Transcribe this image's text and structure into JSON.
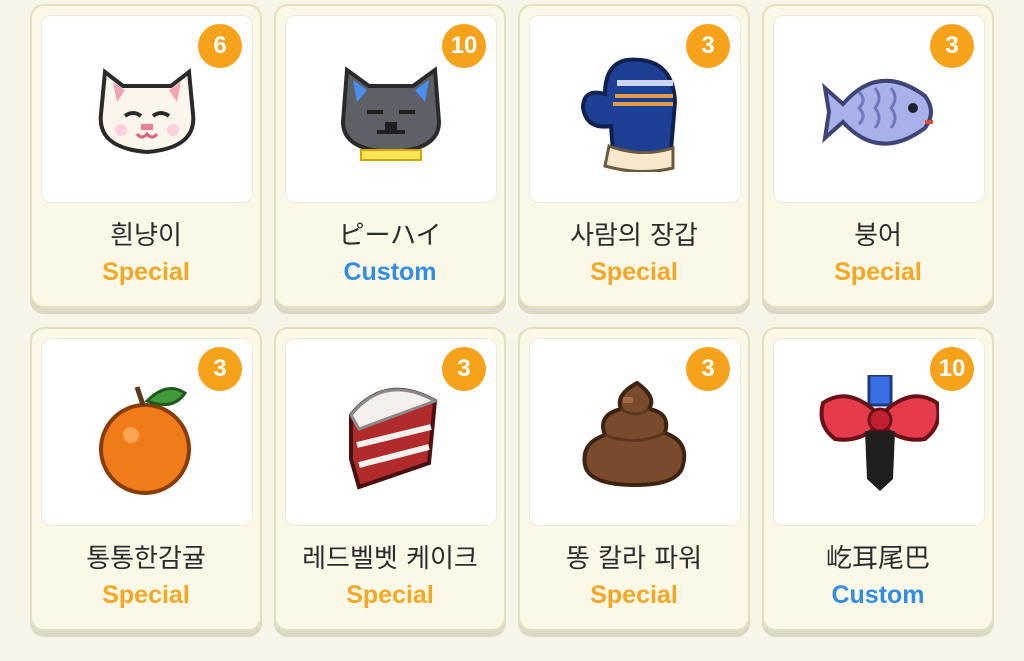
{
  "colors": {
    "special": "#f5a623",
    "custom": "#2f8de4",
    "badge": "#f7a21b"
  },
  "items": [
    {
      "name": "흰냥이",
      "type": "Special",
      "count": "6",
      "icon": "white-cat-icon"
    },
    {
      "name": "ピーハイ",
      "type": "Custom",
      "count": "10",
      "icon": "gray-cat-icon"
    },
    {
      "name": "사람의 장갑",
      "type": "Special",
      "count": "3",
      "icon": "mitten-icon"
    },
    {
      "name": "붕어",
      "type": "Special",
      "count": "3",
      "icon": "fish-icon"
    },
    {
      "name": "통통한감귤",
      "type": "Special",
      "count": "3",
      "icon": "tangerine-icon"
    },
    {
      "name": "레드벨벳 케이크",
      "type": "Special",
      "count": "3",
      "icon": "cake-icon"
    },
    {
      "name": "똥 칼라 파워",
      "type": "Special",
      "count": "3",
      "icon": "poop-icon"
    },
    {
      "name": "屹耳尾巴",
      "type": "Custom",
      "count": "10",
      "icon": "bow-tail-icon"
    }
  ]
}
